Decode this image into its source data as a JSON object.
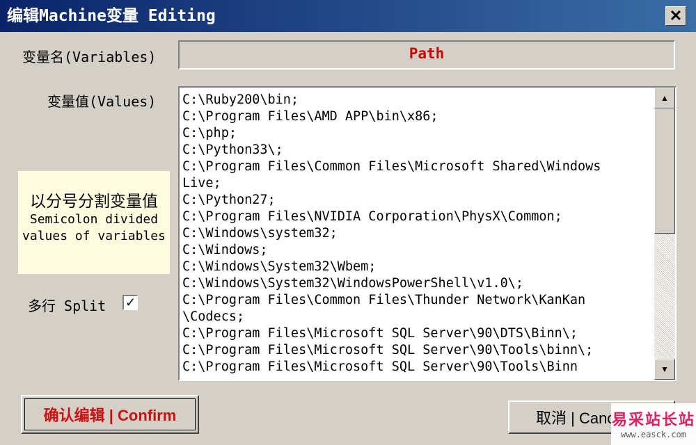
{
  "window": {
    "title": "编辑Machine变量 Editing",
    "close_glyph": "✕"
  },
  "form": {
    "name_label": "变量名(Variables)",
    "name_value": "Path",
    "values_label": "变量值(Values)",
    "value_lines": [
      "C:\\Ruby200\\bin;",
      "C:\\Program Files\\AMD APP\\bin\\x86;",
      "C:\\php;",
      "C:\\Python33\\;",
      "C:\\Program Files\\Common Files\\Microsoft Shared\\Windows",
      "Live;",
      "C:\\Python27;",
      "C:\\Program Files\\NVIDIA Corporation\\PhysX\\Common;",
      "C:\\Windows\\system32;",
      "C:\\Windows;",
      "C:\\Windows\\System32\\Wbem;",
      "C:\\Windows\\System32\\WindowsPowerShell\\v1.0\\;",
      "C:\\Program Files\\Common Files\\Thunder Network\\KanKan",
      "\\Codecs;",
      "C:\\Program Files\\Microsoft SQL Server\\90\\DTS\\Binn\\;",
      "C:\\Program Files\\Microsoft SQL Server\\90\\Tools\\binn\\;",
      "C:\\Program Files\\Microsoft SQL Server\\90\\Tools\\Binn"
    ]
  },
  "hint": {
    "cn": "以分号分割变量值",
    "en": "Semicolon divided values of variables"
  },
  "split": {
    "label": "多行 Split",
    "checked_glyph": "✓"
  },
  "buttons": {
    "confirm": "确认编辑 | Confirm",
    "cancel": "取消 | Cancel"
  },
  "scrollbar": {
    "up_glyph": "▲",
    "down_glyph": "▼"
  },
  "watermark": {
    "cn": "易采站长站",
    "url": "www.easck.com"
  }
}
